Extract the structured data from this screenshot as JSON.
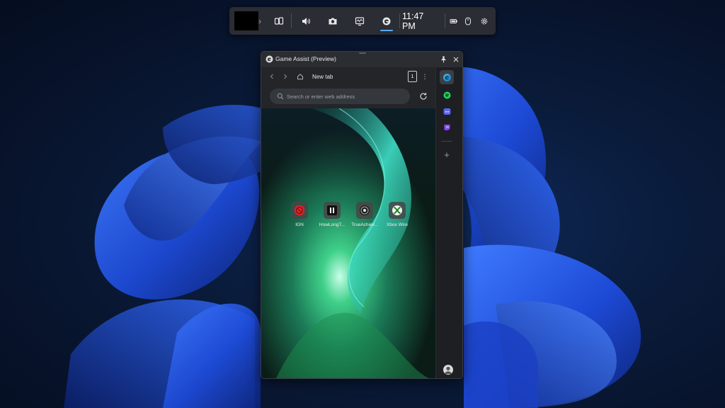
{
  "colors": {
    "desktop_bg": "#0a1a36",
    "bloom_blue": "#1f4fd8",
    "gamebar_bg": "#2a2d33",
    "window_bg": "#1d1f23",
    "accent": "#5aa9f0"
  },
  "gamebar": {
    "time": "11:47 PM",
    "icons": [
      "chevron-right-icon",
      "widget-gallery-icon",
      "volume-icon",
      "camera-icon",
      "performance-icon",
      "edge-icon",
      "battery-icon",
      "mouse-icon",
      "settings-icon"
    ],
    "active_widget": "edge-icon"
  },
  "window": {
    "title": "Game Assist (Preview)"
  },
  "browser": {
    "tab_title": "New tab",
    "tab_count": "1",
    "address_placeholder": "Search or enter web address",
    "shortcuts": [
      {
        "label": "IGN",
        "icon": "ign-icon"
      },
      {
        "label": "HowLongT...",
        "icon": "howlongtobeat-icon"
      },
      {
        "label": "TrueAchiev...",
        "icon": "trueachievements-icon"
      },
      {
        "label": "Xbox Wire",
        "icon": "xbox-icon"
      }
    ]
  },
  "sidebar": {
    "apps": [
      "edge-icon",
      "spotify-icon",
      "discord-icon",
      "twitch-icon"
    ],
    "add_label": "+"
  }
}
